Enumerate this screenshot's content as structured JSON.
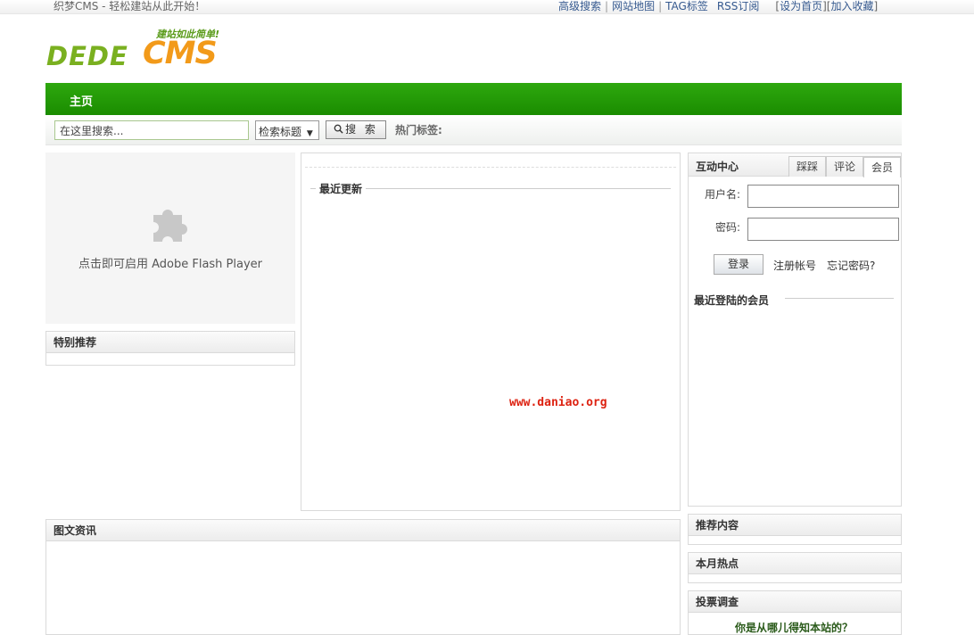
{
  "topbar": {
    "welcome": "织梦CMS - 轻松建站从此开始！",
    "links": {
      "advanced_search": "高级搜索",
      "site_map": "网站地图",
      "tags": "TAG标签",
      "rss": "RSS订阅",
      "set_home": "设为首页",
      "add_favorite": "加入收藏"
    }
  },
  "logo": {
    "brand_left": "DEDE",
    "brand_right": "CMS",
    "slogan": "建站如此简单!"
  },
  "nav": {
    "home": "主页"
  },
  "search": {
    "placeholder": "在这里搜索...",
    "scope": "检索标题",
    "button": "搜 索",
    "hot_tags_label": "热门标签:"
  },
  "flash": {
    "message": "点击即可启用 Adobe Flash Player"
  },
  "featured": {
    "title": "特别推荐"
  },
  "center": {
    "recent_title": "最近更新",
    "site": "www.daniao.org"
  },
  "member": {
    "title": "互动中心",
    "tabs": [
      "踩踩",
      "评论",
      "会员"
    ],
    "username_label": "用户名:",
    "password_label": "密码:",
    "login_button": "登录",
    "register_link": "注册帐号",
    "forgot_link": "忘记密码?",
    "recent_members": "最近登陆的会员"
  },
  "picnews": {
    "title": "图文资讯"
  },
  "recommend": {
    "title": "推荐内容"
  },
  "monthly_hot": {
    "title": "本月热点"
  },
  "poll": {
    "title": "投票调查",
    "question": "你是从哪儿得知本站的？"
  },
  "colors": {
    "nav_green": "#1a8c00",
    "logo_green": "#7ab020",
    "logo_orange": "#f29a1a",
    "link_blue": "#35598f",
    "site_red": "#dd1111"
  }
}
